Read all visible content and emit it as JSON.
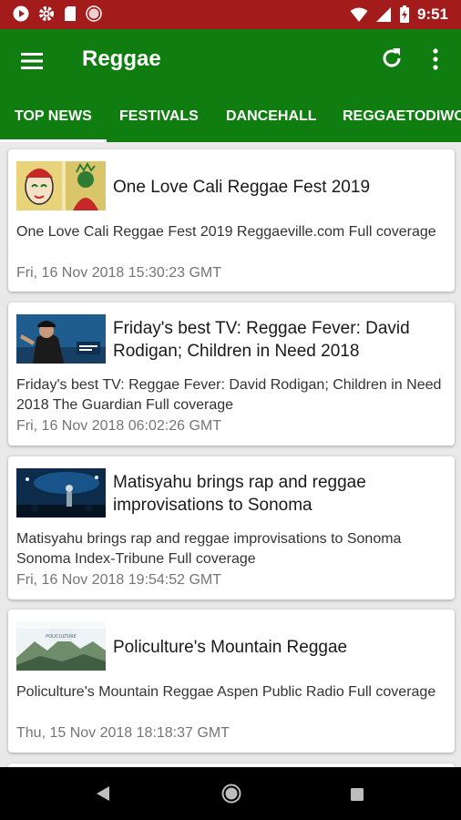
{
  "status_bar": {
    "time": "9:51"
  },
  "app_bar": {
    "title": "Reggae"
  },
  "tabs": [
    {
      "label": "TOP NEWS",
      "active": true
    },
    {
      "label": "FESTIVALS",
      "active": false
    },
    {
      "label": "DANCEHALL",
      "active": false
    },
    {
      "label": "REGGAETODIWO",
      "active": false
    }
  ],
  "articles": [
    {
      "headline": "One Love Cali Reggae Fest 2019",
      "summary": "One Love Cali Reggae Fest 2019  Reggaeville.com  Full coverage",
      "date": "Fri, 16 Nov 2018 15:30:23 GMT"
    },
    {
      "headline": "Friday's best TV: Reggae Fever: David Rodigan; Children in Need 2018",
      "summary": "Friday's best TV: Reggae Fever: David Rodigan; Children in Need 2018  The Guardian  Full coverage",
      "date": "Fri, 16 Nov 2018 06:02:26 GMT"
    },
    {
      "headline": "Matisyahu brings rap and reggae improvisations to Sonoma",
      "summary": "Matisyahu brings rap and reggae improvisations to Sonoma Sonoma Index-Tribune  Full coverage",
      "date": "Fri, 16 Nov 2018 19:54:52 GMT"
    },
    {
      "headline": "Policulture's Mountain Reggae",
      "summary": "Policulture's Mountain Reggae  Aspen Public Radio  Full coverage",
      "date": "Thu, 15 Nov 2018 18:18:37 GMT"
    }
  ],
  "colors": {
    "status_bar": "#a31b1b",
    "app_bar": "#0f7d0f",
    "background": "#e9e9e9"
  }
}
